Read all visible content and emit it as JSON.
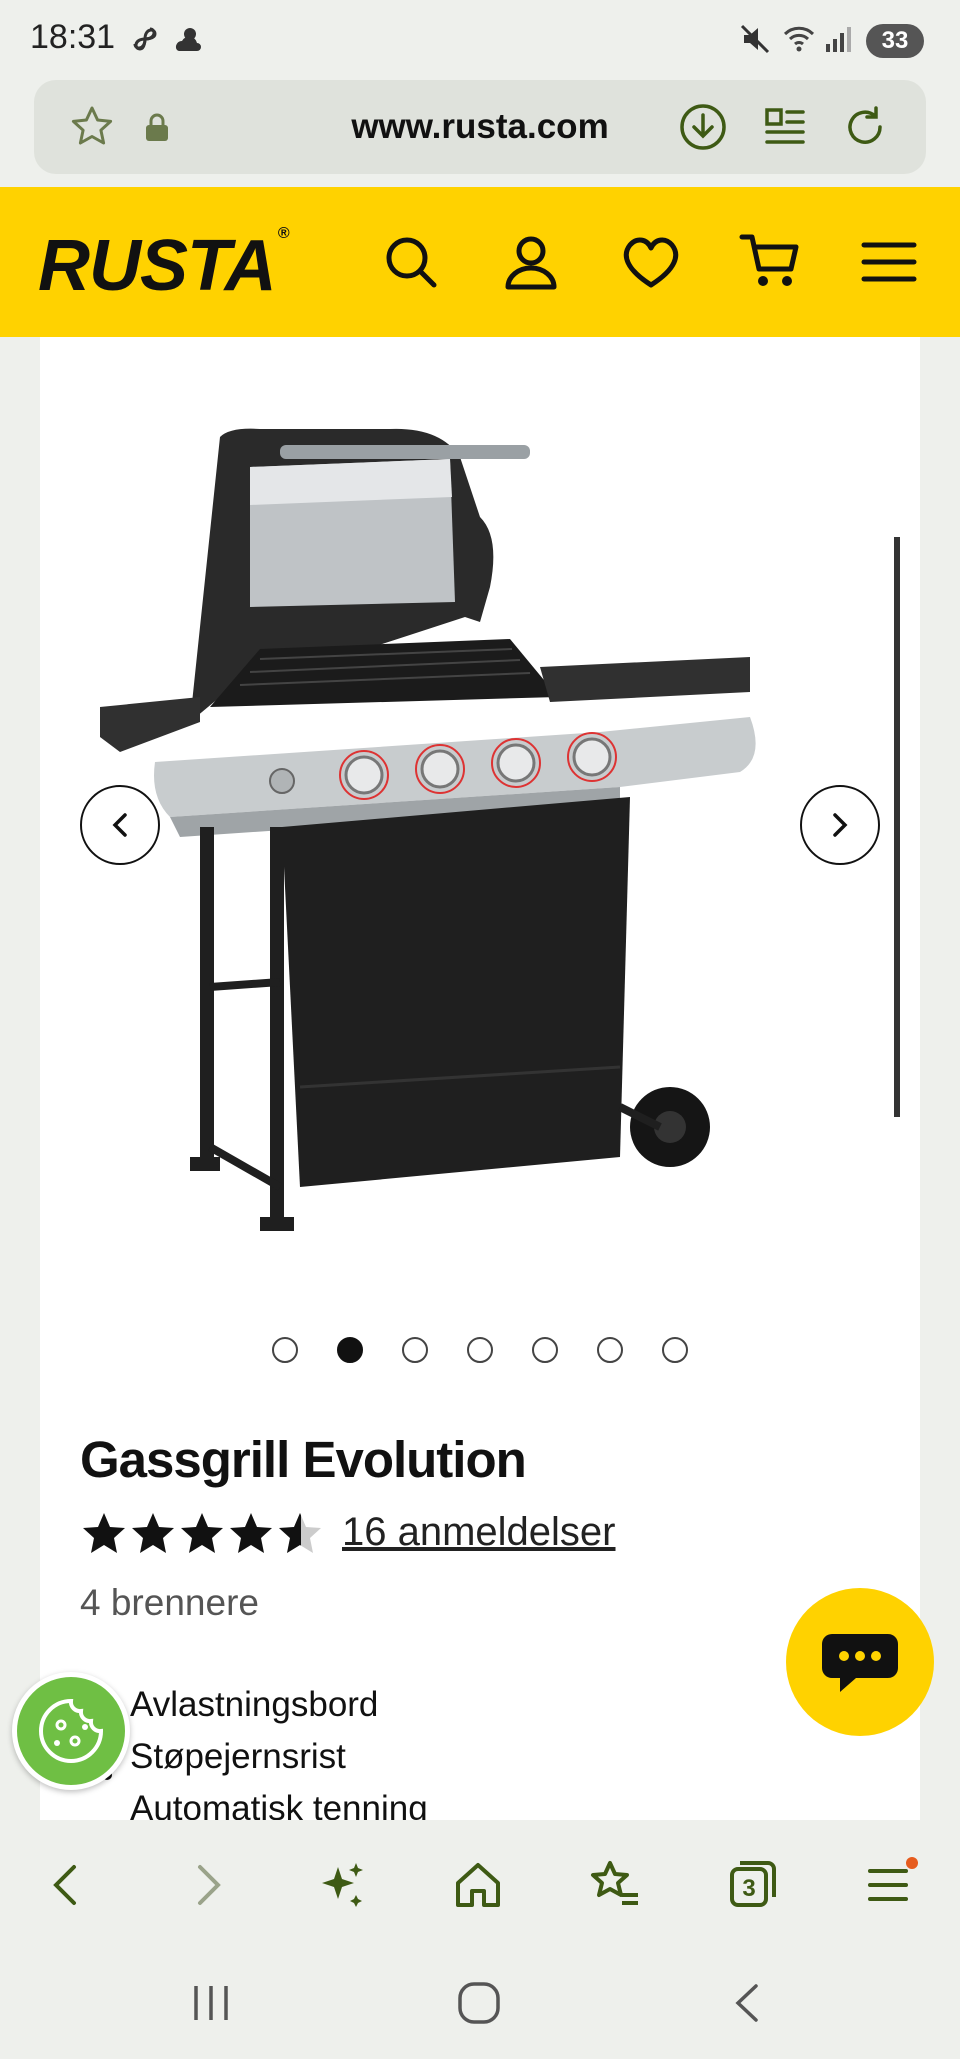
{
  "status_bar": {
    "time": "18:31",
    "battery": "33"
  },
  "browser": {
    "url": "www.rusta.com",
    "tabs_count": "3"
  },
  "site": {
    "brand": "RUSTA",
    "brand_mark": "®",
    "brand_color": "#ffd200"
  },
  "gallery": {
    "image_count": 7,
    "active_index": 1
  },
  "product": {
    "title": "Gassgrill Evolution",
    "rating": 4.5,
    "rating_max": 5,
    "reviews_label": "16 anmeldelser",
    "variant": "4 brennere",
    "features": [
      "Avlastningsbord",
      "Støpejernsrist",
      "Automatisk tenning"
    ]
  },
  "icons": {
    "status": [
      "pinwheel-icon",
      "weather-icon",
      "mute-icon",
      "wifi-icon",
      "signal-icon"
    ],
    "urlbar": [
      "star-icon",
      "lock-icon",
      "download-icon",
      "reader-icon",
      "reload-icon"
    ],
    "header": [
      "search-icon",
      "user-icon",
      "heart-icon",
      "cart-icon",
      "menu-icon"
    ],
    "bottom_nav": [
      "back-icon",
      "forward-icon",
      "sparkle-icon",
      "home-icon",
      "bookmarks-icon",
      "tabs-icon",
      "menu-icon"
    ]
  }
}
